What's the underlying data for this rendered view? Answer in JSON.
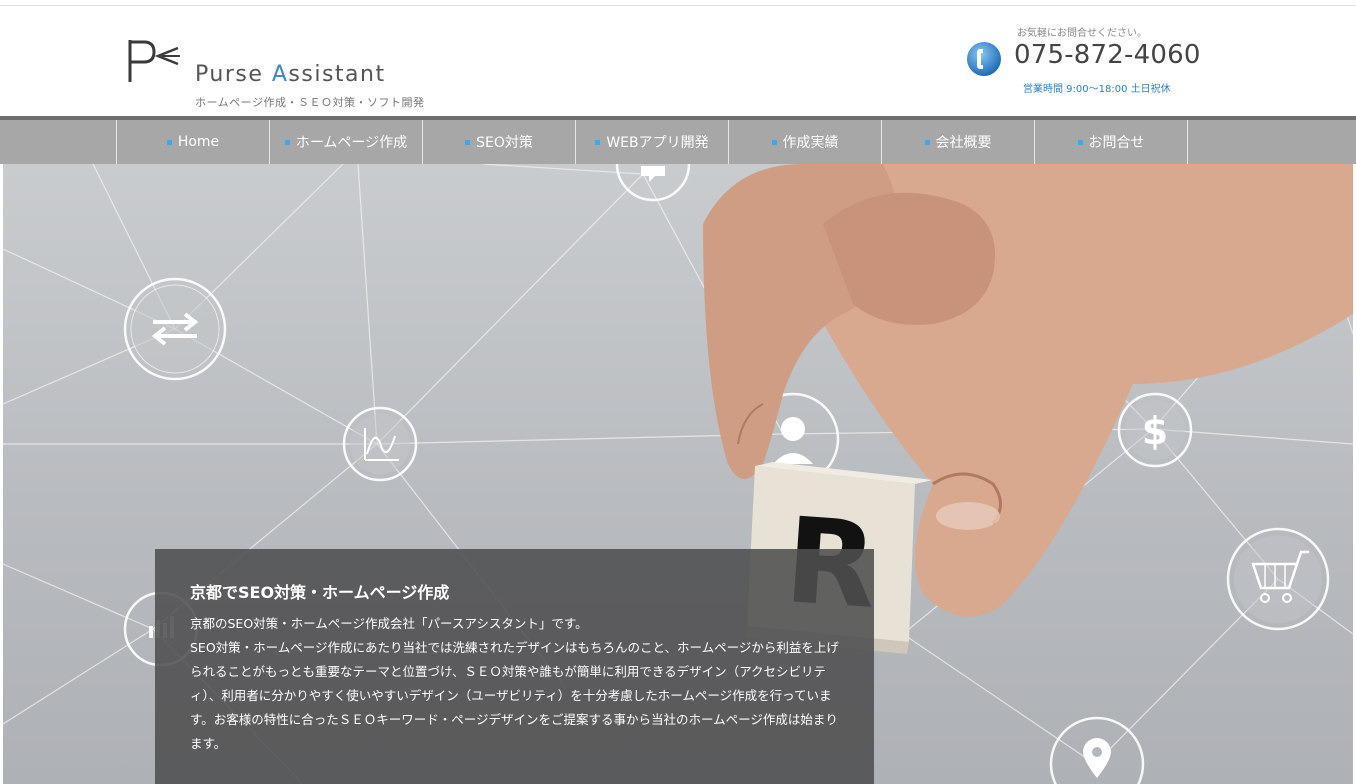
{
  "header": {
    "logo_name_part1": "Purse ",
    "logo_name_accent": "A",
    "logo_name_part2": "ssistant",
    "logo_tagline": "ホームページ作成・ＳＥＯ対策・ソフト開発",
    "contact_note": "お気軽にお問合せください。",
    "phone": "075-872-4060",
    "hours": "営業時間  9:00〜18:00 土日祝休"
  },
  "nav": {
    "items": [
      {
        "label": "Home"
      },
      {
        "label": "ホームページ作成"
      },
      {
        "label": "SEO対策"
      },
      {
        "label": "WEBアプリ開発"
      },
      {
        "label": "作成実績"
      },
      {
        "label": "会社概要"
      },
      {
        "label": "お問合せ"
      }
    ]
  },
  "hero": {
    "block_letter": "R",
    "panel_title": "京都でSEO対策・ホームページ作成",
    "panel_intro": "京都のSEO対策・ホームページ作成会社「パースアシスタント」です。",
    "panel_body": "SEO対策・ホームページ作成にあたり当社では洗練されたデザインはもちろんのこと、ホームページから利益を上げられることがもっとも重要なテーマと位置づけ、ＳＥＯ対策や誰もが簡単に利用できるデザイン（アクセシビリティ）、利用者に分かりやすく使いやすいデザイン（ユーザビリティ）を十分考慮したホームページ作成を行っています。お客様の特性に合ったＳＥＯキーワード・ページデザインをご提案する事から当社のホームページ作成は始まります。"
  },
  "colors": {
    "accent_blue": "#3a86c8",
    "nav_bg": "#a7a7a7",
    "nav_bullet": "#43a6ea",
    "panel_bg": "#4e4e50"
  },
  "icons": [
    "logo-mark-icon",
    "phone-icon",
    "transfer-arrows-icon",
    "chart-line-icon",
    "bar-chart-icon",
    "chat-bubble-icon",
    "person-icon",
    "dollar-icon",
    "shopping-cart-icon",
    "location-pin-icon",
    "hand-image"
  ]
}
